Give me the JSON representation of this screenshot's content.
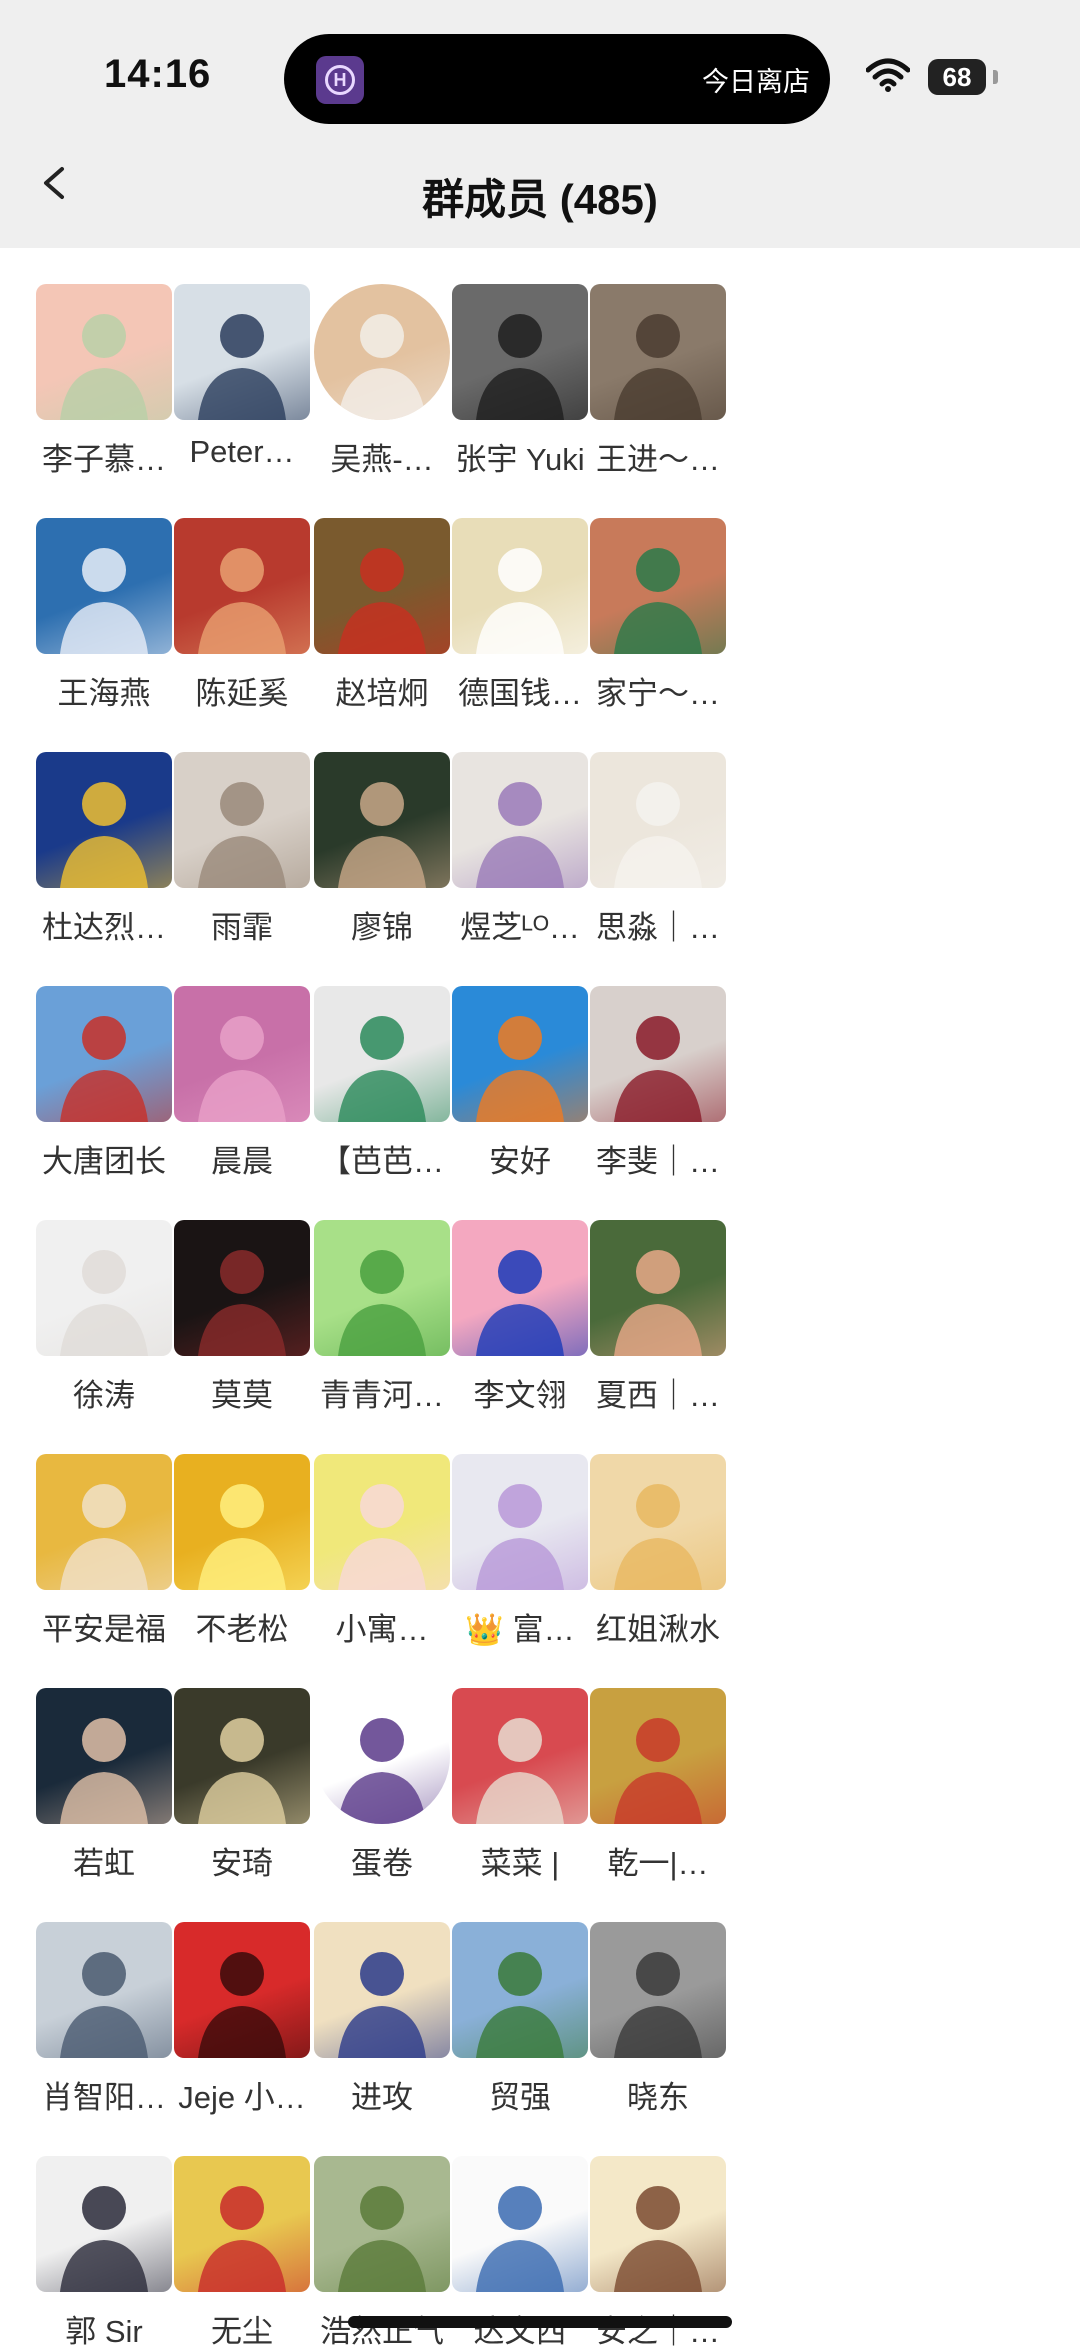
{
  "status_bar": {
    "time": "14:16",
    "island_text": "今日离店",
    "battery": "68"
  },
  "header": {
    "title": "群成员 (485)"
  },
  "members": [
    {
      "name": "李子慕…",
      "bg": "#f4c6b6",
      "fg": "#b8d0a8"
    },
    {
      "name": "Peter…",
      "bg": "#d7dfe6",
      "fg": "#2b3d5c"
    },
    {
      "name": "吴燕-…",
      "bg": "#e3c2a0",
      "fg": "#f2eee8",
      "circle": true
    },
    {
      "name": "张宇 Yuki",
      "bg": "#6a6a6a",
      "fg": "#1e1e1e"
    },
    {
      "name": "王进～…",
      "bg": "#8a7a6a",
      "fg": "#4a3c30"
    },
    {
      "name": "王海燕",
      "bg": "#2d6fb0",
      "fg": "#e8eef8"
    },
    {
      "name": "陈延奚",
      "bg": "#b83a2e",
      "fg": "#e8a070"
    },
    {
      "name": "赵培炯",
      "bg": "#7a5a2e",
      "fg": "#c83020"
    },
    {
      "name": "德国钱…",
      "bg": "#e8ddb8",
      "fg": "#ffffff"
    },
    {
      "name": "家宁～…",
      "bg": "#c87a5a",
      "fg": "#2a7a4a"
    },
    {
      "name": "杜达烈…",
      "bg": "#1a3a8a",
      "fg": "#f0c030"
    },
    {
      "name": "雨霏",
      "bg": "#d8d0c8",
      "fg": "#9a8a7a"
    },
    {
      "name": "廖锦",
      "bg": "#2a3a2a",
      "fg": "#c8a888"
    },
    {
      "name": "煜芝ᴸᴼ…",
      "bg": "#e8e4e0",
      "fg": "#9a7ab8"
    },
    {
      "name": "思淼｜…",
      "bg": "#ece6dc",
      "fg": "#f5f2ee"
    },
    {
      "name": "大唐团长",
      "bg": "#6aa0d8",
      "fg": "#c83028"
    },
    {
      "name": "晨晨",
      "bg": "#c870a8",
      "fg": "#e8a0c8"
    },
    {
      "name": "【芭芭…",
      "bg": "#e8e8e8",
      "fg": "#2a8a5a"
    },
    {
      "name": "安好",
      "bg": "#2a8ad8",
      "fg": "#f07a20"
    },
    {
      "name": "李斐｜…",
      "bg": "#d8d0cc",
      "fg": "#8a1a28"
    },
    {
      "name": "徐涛",
      "bg": "#f0f0f0",
      "fg": "#e0dcd8"
    },
    {
      "name": "莫莫",
      "bg": "#1a1414",
      "fg": "#8a2a2a"
    },
    {
      "name": "青青河…",
      "bg": "#a8e088",
      "fg": "#4aa040"
    },
    {
      "name": "李文翎",
      "bg": "#f4a8c0",
      "fg": "#1a3ab8"
    },
    {
      "name": "夏西｜…",
      "bg": "#4a6a3a",
      "fg": "#e8a888"
    },
    {
      "name": "平安是福",
      "bg": "#e8b840",
      "fg": "#f0e0c8"
    },
    {
      "name": "不老松",
      "bg": "#e8b020",
      "fg": "#fff080"
    },
    {
      "name": "小寓…",
      "bg": "#f0e87a",
      "fg": "#f8d8d8"
    },
    {
      "name": "👑 富…",
      "bg": "#e8e8f0",
      "fg": "#b898d8"
    },
    {
      "name": "红姐湫水",
      "bg": "#f0d8a8",
      "fg": "#e8b860"
    },
    {
      "name": "若虹",
      "bg": "#1a2a3a",
      "fg": "#e0c0a8"
    },
    {
      "name": "安琦",
      "bg": "#3a3a2a",
      "fg": "#e0d0a0"
    },
    {
      "name": "蛋卷",
      "bg": "#ffffff",
      "fg": "#5a3a8a",
      "circle": true
    },
    {
      "name": "菜菜 |",
      "bg": "#d84a50",
      "fg": "#e8dcd0"
    },
    {
      "name": "乾一|…",
      "bg": "#c8a040",
      "fg": "#c83a2a"
    },
    {
      "name": "肖智阳…",
      "bg": "#c8d0d8",
      "fg": "#4a5a70"
    },
    {
      "name": "Jeje 小…",
      "bg": "#d82a2a",
      "fg": "#3a0a0a"
    },
    {
      "name": "进攻",
      "bg": "#f0e0c0",
      "fg": "#2a3a8a"
    },
    {
      "name": "贸强",
      "bg": "#8ab0d8",
      "fg": "#3a7a3a"
    },
    {
      "name": "晓东",
      "bg": "#9a9a9a",
      "fg": "#3a3a3a"
    },
    {
      "name": "郭 Sir",
      "bg": "#f0f0f0",
      "fg": "#2a2a3a"
    },
    {
      "name": "无尘",
      "bg": "#e8c850",
      "fg": "#c82a2a"
    },
    {
      "name": "浩然正气",
      "bg": "#a8b890",
      "fg": "#5a7a3a"
    },
    {
      "name": "达文西",
      "bg": "#fafafa",
      "fg": "#3a6ab0"
    },
    {
      "name": "安之｜…",
      "bg": "#f4e8c8",
      "fg": "#7a4a30"
    }
  ]
}
